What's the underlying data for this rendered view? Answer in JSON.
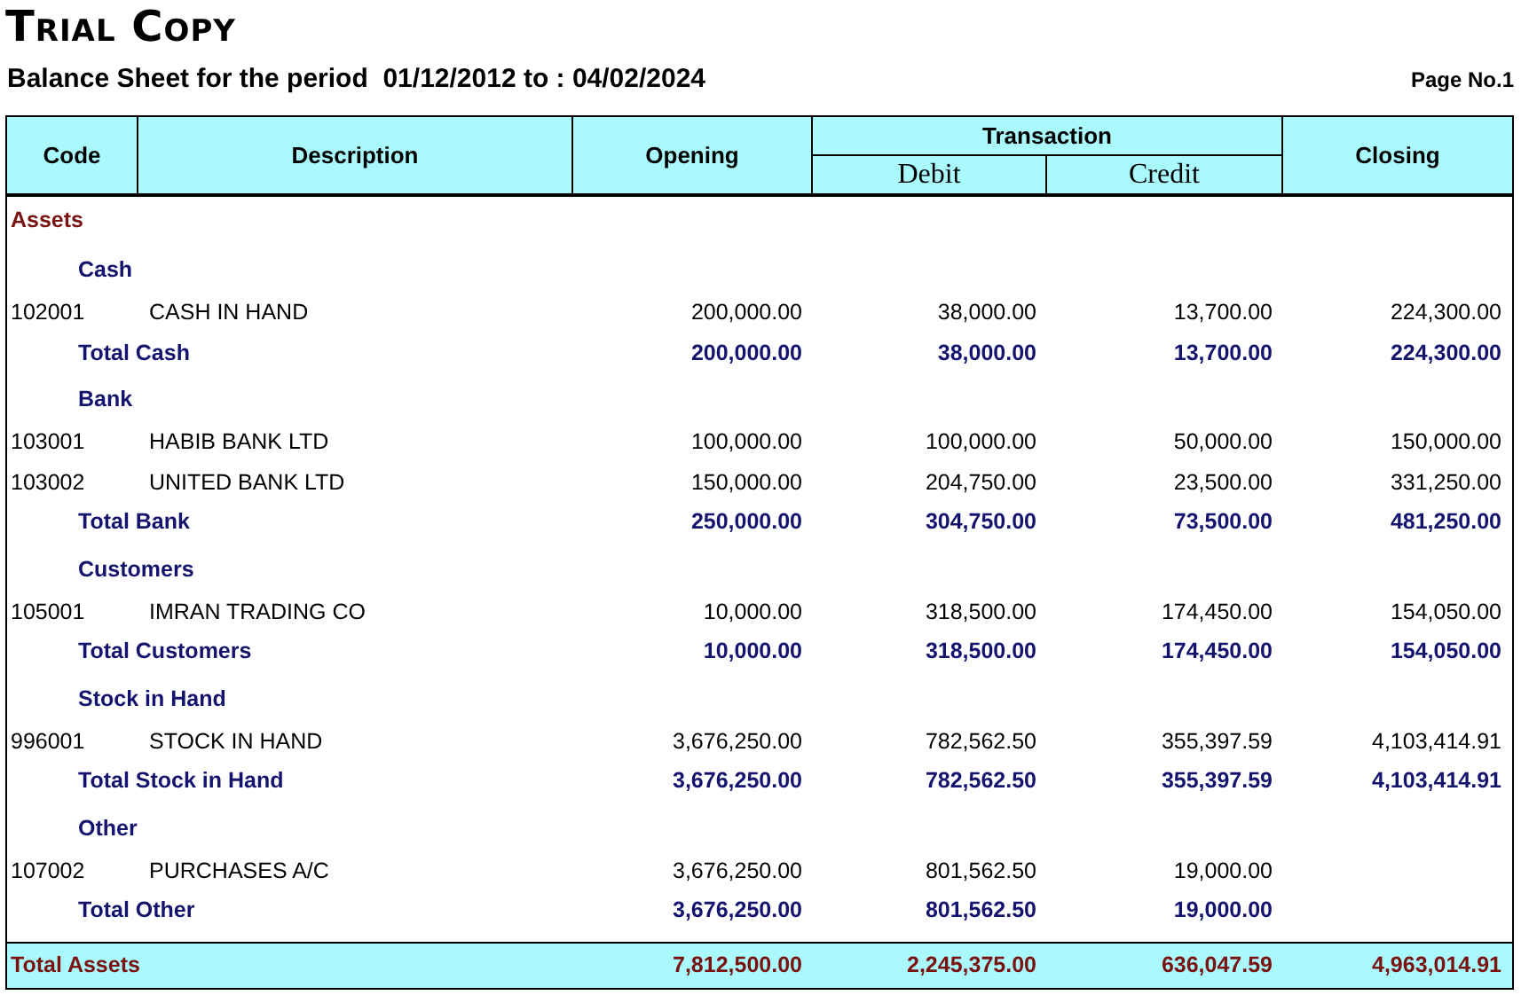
{
  "title": "Trial Copy",
  "subtitle": "Balance Sheet for the period  01/12/2012 to : 04/02/2024",
  "page_no": "Page No.1",
  "table": {
    "columns": {
      "code": "Code",
      "description": "Description",
      "opening": "Opening",
      "transaction": "Transaction",
      "debit": "Debit",
      "credit": "Credit",
      "closing": "Closing"
    },
    "rows": [
      {
        "kind": "section",
        "label": "Assets"
      },
      {
        "kind": "group",
        "label": "Cash"
      },
      {
        "kind": "item",
        "code": "102001",
        "description": "CASH IN HAND",
        "opening": "200,000.00",
        "debit": "38,000.00",
        "credit": "13,700.00",
        "closing": "224,300.00"
      },
      {
        "kind": "total",
        "description": "Total Cash",
        "opening": "200,000.00",
        "debit": "38,000.00",
        "credit": "13,700.00",
        "closing": "224,300.00"
      },
      {
        "kind": "group",
        "label": "Bank"
      },
      {
        "kind": "item",
        "code": "103001",
        "description": "HABIB BANK LTD",
        "opening": "100,000.00",
        "debit": "100,000.00",
        "credit": "50,000.00",
        "closing": "150,000.00"
      },
      {
        "kind": "item",
        "code": "103002",
        "description": "UNITED BANK LTD",
        "opening": "150,000.00",
        "debit": "204,750.00",
        "credit": "23,500.00",
        "closing": "331,250.00"
      },
      {
        "kind": "total",
        "description": "Total Bank",
        "opening": "250,000.00",
        "debit": "304,750.00",
        "credit": "73,500.00",
        "closing": "481,250.00"
      },
      {
        "kind": "group",
        "label": "Customers"
      },
      {
        "kind": "item",
        "code": "105001",
        "description": "IMRAN TRADING CO",
        "opening": "10,000.00",
        "debit": "318,500.00",
        "credit": "174,450.00",
        "closing": "154,050.00"
      },
      {
        "kind": "total",
        "description": "Total Customers",
        "opening": "10,000.00",
        "debit": "318,500.00",
        "credit": "174,450.00",
        "closing": "154,050.00"
      },
      {
        "kind": "group",
        "label": "Stock in Hand"
      },
      {
        "kind": "item",
        "code": "996001",
        "description": "STOCK IN HAND",
        "opening": "3,676,250.00",
        "debit": "782,562.50",
        "credit": "355,397.59",
        "closing": "4,103,414.91"
      },
      {
        "kind": "total",
        "description": "Total Stock in Hand",
        "opening": "3,676,250.00",
        "debit": "782,562.50",
        "credit": "355,397.59",
        "closing": "4,103,414.91"
      },
      {
        "kind": "group",
        "label": "Other"
      },
      {
        "kind": "item",
        "code": "107002",
        "description": "PURCHASES A/C",
        "opening": "3,676,250.00",
        "debit": "801,562.50",
        "credit": "19,000.00"
      },
      {
        "kind": "total",
        "description": "Total Other",
        "opening": "3,676,250.00",
        "debit": "801,562.50",
        "credit": "19,000.00"
      },
      {
        "kind": "grand",
        "description": "Total Assets",
        "opening": "7,812,500.00",
        "debit": "2,245,375.00",
        "credit": "636,047.59",
        "closing": "4,963,014.91"
      }
    ]
  }
}
